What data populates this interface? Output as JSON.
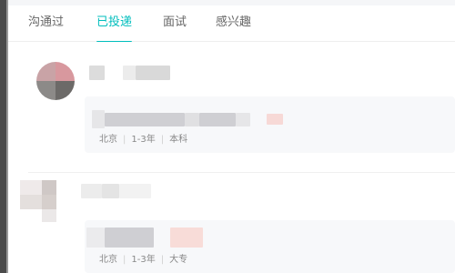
{
  "tabs": [
    {
      "label": "沟通过",
      "active": false
    },
    {
      "label": "已投递",
      "active": true
    },
    {
      "label": "面试",
      "active": false
    },
    {
      "label": "感兴趣",
      "active": false
    }
  ],
  "accent_color": "#00bebd",
  "cards": [
    {
      "meta": {
        "location": "北京",
        "experience": "1-3年",
        "education": "本科"
      }
    },
    {
      "meta": {
        "location": "北京",
        "experience": "1-3年",
        "education": "大专"
      }
    }
  ]
}
